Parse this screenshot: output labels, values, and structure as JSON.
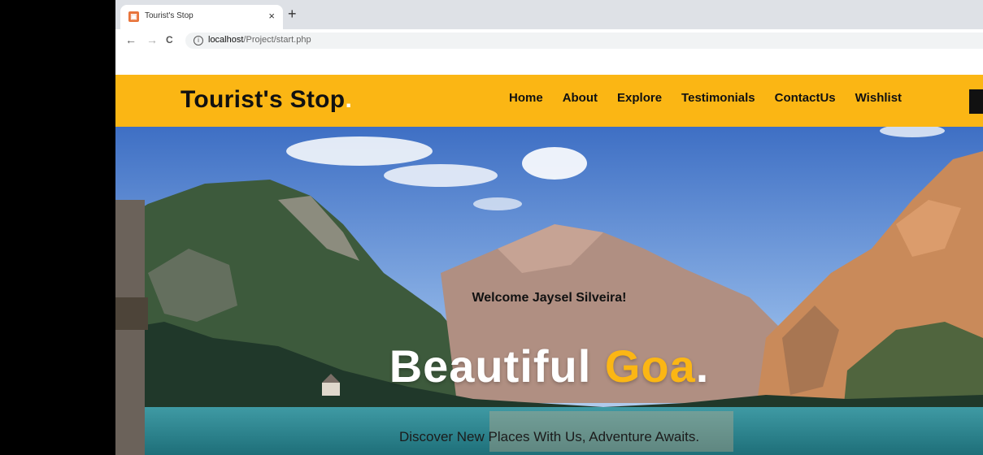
{
  "browser": {
    "tab_title": "Tourist's Stop",
    "tab_close": "×",
    "new_tab": "+",
    "back": "←",
    "forward": "→",
    "reload": "C",
    "url_host": "localhost",
    "url_path": "/Project/start.php"
  },
  "header": {
    "logo_text": "Tourist's Stop",
    "logo_dot": ".",
    "nav": [
      "Home",
      "About",
      "Explore",
      "Testimonials",
      "ContactUs",
      "Wishlist"
    ]
  },
  "hero": {
    "welcome": "Welcome Jaysel Silveira!",
    "headline_main": "Beautiful",
    "headline_accent": "Goa",
    "headline_dot": ".",
    "tagline": "Discover New Places With Us, Adventure Awaits."
  },
  "colors": {
    "accent": "#fbb614",
    "text_dark": "#111111"
  }
}
